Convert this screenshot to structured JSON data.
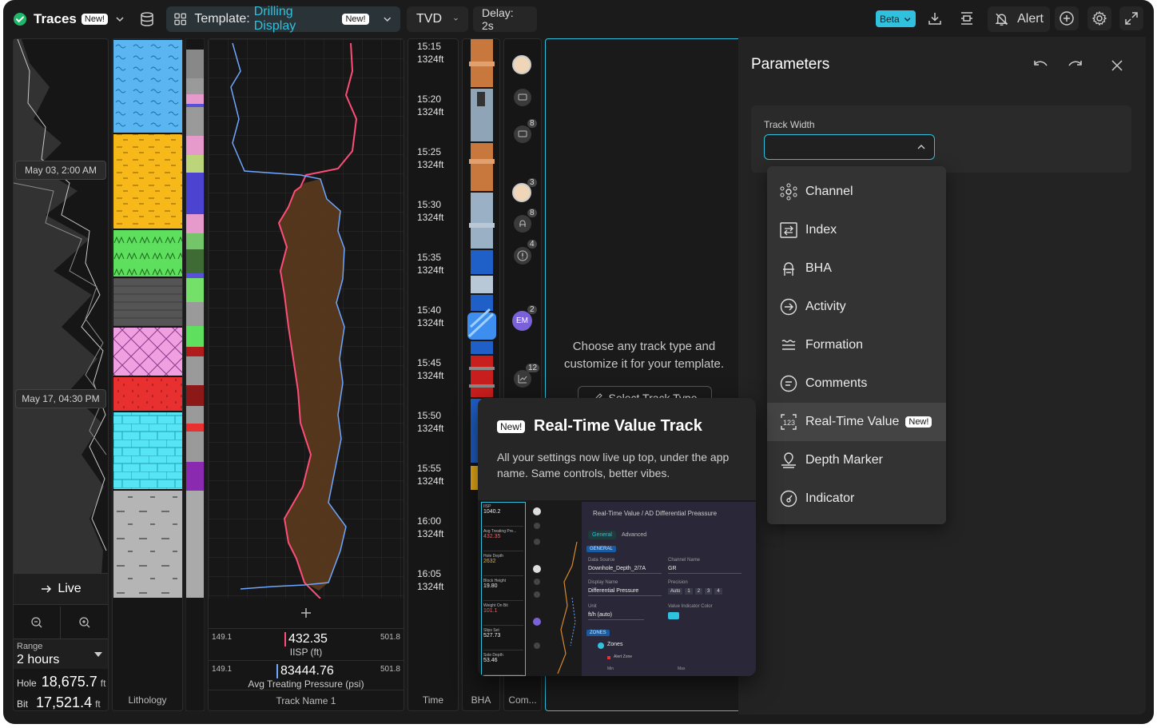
{
  "topbar": {
    "app_name": "Traces",
    "new_badge": "New!",
    "template_prefix": "Template:",
    "template_name": "Drilling Display",
    "template_badge": "New!",
    "depth_mode": "TVD",
    "delay": "Delay: 2s",
    "beta_label": "Beta",
    "alert_label": "Alert",
    "colors": {
      "accent": "#2fc1dd",
      "success": "#1fb86b"
    }
  },
  "overview": {
    "date_top": "May 03, 2:00 AM",
    "date_bottom": "May 17, 04:30 PM",
    "live_label": "Live",
    "range_label": "Range",
    "range_value": "2 hours",
    "hole_label": "Hole",
    "hole_value": "18,675.7",
    "hole_unit": "ft",
    "bit_label": "Bit",
    "bit_value": "17,521.4",
    "bit_unit": "ft"
  },
  "lithology": {
    "label": "Lithology"
  },
  "curve_track": {
    "ch1_min": "149.1",
    "ch1_value": "432.35",
    "ch1_max": "501.8",
    "ch1_name": "IISP (ft)",
    "ch2_min": "149.1",
    "ch2_value": "83444.76",
    "ch2_max": "501.8",
    "ch2_name": "Avg Treating Pressure (psi)",
    "track_name": "Track Name 1",
    "colors": {
      "ch1": "#ff4d79",
      "ch2": "#6fa6ff",
      "fill": "#5a3a1c"
    }
  },
  "time_track": {
    "label": "Time",
    "ticks": [
      {
        "time": "15:15",
        "depth": "1324ft"
      },
      {
        "time": "15:20",
        "depth": "1324ft"
      },
      {
        "time": "15:25",
        "depth": "1324ft"
      },
      {
        "time": "15:30",
        "depth": "1324ft"
      },
      {
        "time": "15:35",
        "depth": "1324ft"
      },
      {
        "time": "15:40",
        "depth": "1324ft"
      },
      {
        "time": "15:45",
        "depth": "1324ft"
      },
      {
        "time": "15:50",
        "depth": "1324ft"
      },
      {
        "time": "15:55",
        "depth": "1324ft"
      },
      {
        "time": "16:00",
        "depth": "1324ft"
      },
      {
        "time": "16:05",
        "depth": "1324ft"
      }
    ]
  },
  "bha_track": {
    "label": "BHA"
  },
  "comments_track": {
    "label": "Com...",
    "badges": [
      "8",
      "3",
      "8",
      "4",
      "2",
      "12"
    ],
    "avatar_initials": "EM"
  },
  "empty_track": {
    "message": "Choose any track type and customize it for your template.",
    "button_label": "Select Track Type"
  },
  "popup": {
    "badge": "New!",
    "title": "Real-Time Value Track",
    "description": "All your settings now live up top, under the app name. Same controls, better vibes.",
    "preview": {
      "breadcrumb": "Real-Time Value / AD Differential Preassure",
      "tab_general": "General",
      "tab_advanced": "Advanced",
      "section_general": "GENERAL",
      "data_source_label": "Data Source",
      "data_source_value": "Downhole_Depth_2/7A",
      "channel_label": "Channel Name",
      "channel_value": "GR",
      "display_label": "Display Name",
      "display_value": "Differential Pressure",
      "precision_label": "Precision",
      "precision_options": [
        "Auto",
        "1",
        "2",
        "3",
        "4"
      ],
      "unit_label": "Unit",
      "unit_value": "ft/h (auto)",
      "indicator_label": "Value Indicator Color",
      "section_zones": "ZONES",
      "zones_label": "Zones",
      "alert_zone_label": "Alert Zone",
      "min_label": "Min",
      "max_label": "Max",
      "rt_rows": [
        {
          "name": "IISP",
          "value": "1040.2"
        },
        {
          "name": "Avg Treating Pre...",
          "value": "432.35"
        },
        {
          "name": "Hole Depth",
          "value": "2632"
        },
        {
          "name": "Block Height",
          "value": "19.80"
        },
        {
          "name": "Weight On Bit",
          "value": "101.1"
        },
        {
          "name": "Slips Set",
          "value": "527.73"
        },
        {
          "name": "Sole Depth",
          "value": "53.46"
        }
      ]
    }
  },
  "parameters": {
    "title": "Parameters",
    "field_label": "Track Width",
    "menu": [
      {
        "label": "Channel",
        "icon": "channel-icon"
      },
      {
        "label": "Index",
        "icon": "index-icon"
      },
      {
        "label": "BHA",
        "icon": "bha-icon"
      },
      {
        "label": "Activity",
        "icon": "activity-icon"
      },
      {
        "label": "Formation",
        "icon": "formation-icon"
      },
      {
        "label": "Comments",
        "icon": "comments-icon"
      },
      {
        "label": "Real-Time Value",
        "icon": "realtime-value-icon",
        "badge": "New!"
      },
      {
        "label": "Depth Marker",
        "icon": "depth-marker-icon"
      },
      {
        "label": "Indicator",
        "icon": "indicator-icon"
      }
    ]
  }
}
